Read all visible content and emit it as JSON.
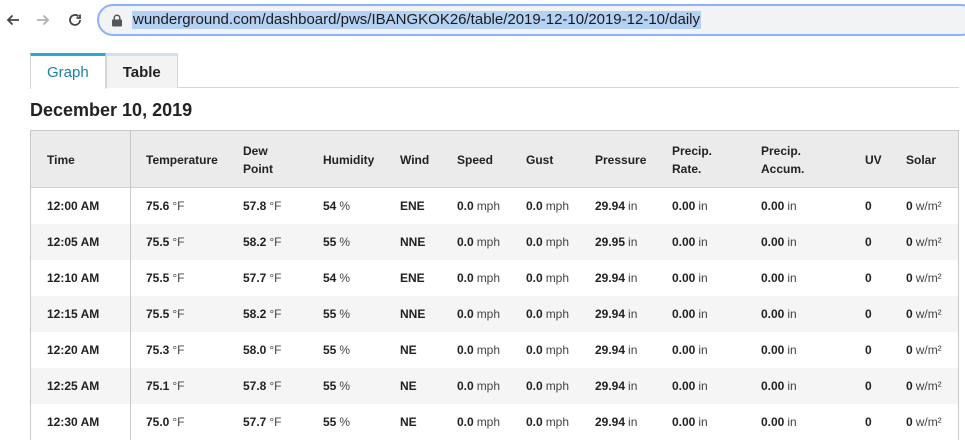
{
  "browser": {
    "url": "wunderground.com/dashboard/pws/IBANGKOK26/table/2019-12-10/2019-12-10/daily"
  },
  "tabs": [
    {
      "label": "Graph"
    },
    {
      "label": "Table"
    }
  ],
  "page": {
    "date_title": "December 10, 2019"
  },
  "table": {
    "headers": {
      "time": "Time",
      "temperature": "Temperature",
      "dew_point_1": "Dew",
      "dew_point_2": "Point",
      "humidity": "Humidity",
      "wind": "Wind",
      "speed": "Speed",
      "gust": "Gust",
      "pressure": "Pressure",
      "precip_rate_1": "Precip.",
      "precip_rate_2": "Rate.",
      "precip_accum_1": "Precip.",
      "precip_accum_2": "Accum.",
      "uv": "UV",
      "solar": "Solar"
    },
    "units": {
      "temperature": "°F",
      "dew_point": "°F",
      "humidity": "%",
      "speed": "mph",
      "gust": "mph",
      "pressure": "in",
      "precip_rate": "in",
      "precip_accum": "in",
      "solar": "w/m²"
    },
    "rows": [
      {
        "time": "12:00 AM",
        "temperature": "75.6",
        "dew_point": "57.8",
        "humidity": "54",
        "wind": "ENE",
        "speed": "0.0",
        "gust": "0.0",
        "pressure": "29.94",
        "precip_rate": "0.00",
        "precip_accum": "0.00",
        "uv": "0",
        "solar": "0"
      },
      {
        "time": "12:05 AM",
        "temperature": "75.5",
        "dew_point": "58.2",
        "humidity": "55",
        "wind": "NNE",
        "speed": "0.0",
        "gust": "0.0",
        "pressure": "29.95",
        "precip_rate": "0.00",
        "precip_accum": "0.00",
        "uv": "0",
        "solar": "0"
      },
      {
        "time": "12:10 AM",
        "temperature": "75.5",
        "dew_point": "57.7",
        "humidity": "54",
        "wind": "ENE",
        "speed": "0.0",
        "gust": "0.0",
        "pressure": "29.94",
        "precip_rate": "0.00",
        "precip_accum": "0.00",
        "uv": "0",
        "solar": "0"
      },
      {
        "time": "12:15 AM",
        "temperature": "75.5",
        "dew_point": "58.2",
        "humidity": "55",
        "wind": "NNE",
        "speed": "0.0",
        "gust": "0.0",
        "pressure": "29.94",
        "precip_rate": "0.00",
        "precip_accum": "0.00",
        "uv": "0",
        "solar": "0"
      },
      {
        "time": "12:20 AM",
        "temperature": "75.3",
        "dew_point": "58.0",
        "humidity": "55",
        "wind": "NE",
        "speed": "0.0",
        "gust": "0.0",
        "pressure": "29.94",
        "precip_rate": "0.00",
        "precip_accum": "0.00",
        "uv": "0",
        "solar": "0"
      },
      {
        "time": "12:25 AM",
        "temperature": "75.1",
        "dew_point": "57.8",
        "humidity": "55",
        "wind": "NE",
        "speed": "0.0",
        "gust": "0.0",
        "pressure": "29.94",
        "precip_rate": "0.00",
        "precip_accum": "0.00",
        "uv": "0",
        "solar": "0"
      },
      {
        "time": "12:30 AM",
        "temperature": "75.0",
        "dew_point": "57.7",
        "humidity": "55",
        "wind": "NE",
        "speed": "0.0",
        "gust": "0.0",
        "pressure": "29.94",
        "precip_rate": "0.00",
        "precip_accum": "0.00",
        "uv": "0",
        "solar": "0"
      }
    ]
  }
}
